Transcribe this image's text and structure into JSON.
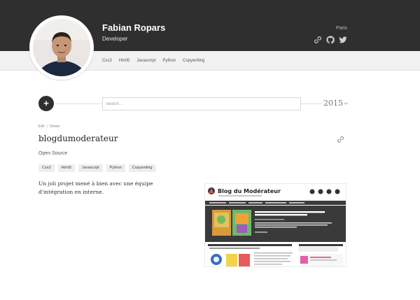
{
  "profile": {
    "name": "Fabian Ropars",
    "role": "Developer",
    "location": "Paris",
    "skills": [
      "Css3",
      "Html5",
      "Javascript",
      "Python",
      "Copywriting"
    ],
    "social_icons": [
      "link-icon",
      "github-icon",
      "twitter-icon"
    ]
  },
  "toolbar": {
    "add_label": "+",
    "search_placeholder": "Search...",
    "year": "2015"
  },
  "post": {
    "actions": [
      "Edit",
      "Delete"
    ],
    "title": "blogdumoderateur",
    "category": "Open Source",
    "tags": [
      "Css3",
      "Html5",
      "Javascript",
      "Python",
      "Copywriting"
    ],
    "description": "Un joli projet mené à bien avec une équipe d'intégration en interne.",
    "screenshot": {
      "site_title": "Blog du Modérateur",
      "headline": "LE MEILLEUR JOB DES INTERNETS : BIBLIOTHÉCAIRE DE MÈMES CHEZ TUMBLR"
    }
  },
  "colors": {
    "header_bg": "#2f2f2f",
    "subbar_bg": "#f2f2f2",
    "tag_bg": "#eeeeee"
  }
}
